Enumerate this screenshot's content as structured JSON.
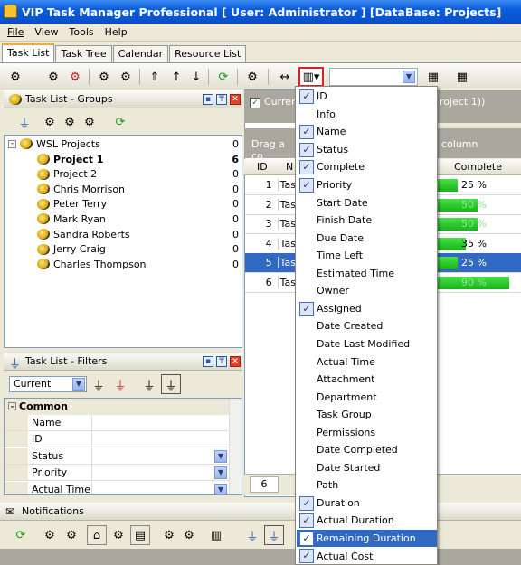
{
  "window": {
    "title": "VIP Task Manager Professional [ User: Administrator ] [DataBase: Projects]"
  },
  "menu": [
    "File",
    "View",
    "Tools",
    "Help"
  ],
  "tabs": [
    "Task List",
    "Task Tree",
    "Calendar",
    "Resource List"
  ],
  "groups_panel": {
    "title": "Task List - Groups",
    "root": {
      "label": "WSL Projects",
      "count": "0"
    },
    "items": [
      {
        "label": "Project 1",
        "count": "6"
      },
      {
        "label": "Project 2",
        "count": "0"
      },
      {
        "label": "Chris Morrison",
        "count": "0"
      },
      {
        "label": "Peter Terry",
        "count": "0"
      },
      {
        "label": "Mark Ryan",
        "count": "0"
      },
      {
        "label": "Sandra Roberts",
        "count": "0"
      },
      {
        "label": "Jerry Craig",
        "count": "0"
      },
      {
        "label": "Charles Thompson",
        "count": "0"
      }
    ]
  },
  "filters_panel": {
    "title": "Task List - Filters",
    "current": "Current",
    "section": "Common",
    "props": [
      "Name",
      "ID",
      "Status",
      "Priority",
      "Actual Time"
    ]
  },
  "grid": {
    "current_label": "Curren",
    "group_hint": "Drag a co",
    "group_hint2": "column",
    "caption_tail": "roject 1))",
    "columns": {
      "id": "ID",
      "name": "N",
      "complete": "Complete"
    },
    "rows": [
      {
        "id": "1",
        "name": "Tas",
        "complete": "25 %",
        "pct": 25
      },
      {
        "id": "2",
        "name": "Tas",
        "complete": "50 %",
        "pct": 50
      },
      {
        "id": "3",
        "name": "Tas",
        "complete": "50 %",
        "pct": 50
      },
      {
        "id": "4",
        "name": "Tas",
        "complete": "35 %",
        "pct": 35
      },
      {
        "id": "5",
        "name": "Tas",
        "complete": "25 %",
        "pct": 25
      },
      {
        "id": "6",
        "name": "Tas",
        "complete": "90 %",
        "pct": 90
      }
    ],
    "footer_count": "6"
  },
  "column_menu": [
    {
      "label": "ID",
      "checked": true
    },
    {
      "label": "Info",
      "checked": false
    },
    {
      "label": "Name",
      "checked": true
    },
    {
      "label": "Status",
      "checked": true
    },
    {
      "label": "Complete",
      "checked": true
    },
    {
      "label": "Priority",
      "checked": true
    },
    {
      "label": "Start Date",
      "checked": false
    },
    {
      "label": "Finish Date",
      "checked": false
    },
    {
      "label": "Due Date",
      "checked": false
    },
    {
      "label": "Time Left",
      "checked": false
    },
    {
      "label": "Estimated Time",
      "checked": false
    },
    {
      "label": "Owner",
      "checked": false
    },
    {
      "label": "Assigned",
      "checked": true
    },
    {
      "label": "Date Created",
      "checked": false
    },
    {
      "label": "Date Last Modified",
      "checked": false
    },
    {
      "label": "Actual Time",
      "checked": false
    },
    {
      "label": "Attachment",
      "checked": false
    },
    {
      "label": "Department",
      "checked": false
    },
    {
      "label": "Task Group",
      "checked": false
    },
    {
      "label": "Permissions",
      "checked": false
    },
    {
      "label": "Date Completed",
      "checked": false
    },
    {
      "label": "Date Started",
      "checked": false
    },
    {
      "label": "Path",
      "checked": false
    },
    {
      "label": "Duration",
      "checked": true
    },
    {
      "label": "Actual Duration",
      "checked": true
    },
    {
      "label": "Remaining Duration",
      "checked": true,
      "highlight": true
    },
    {
      "label": "Actual Cost",
      "checked": true
    }
  ],
  "notifications": {
    "title": "Notifications"
  },
  "colors": {
    "accent": "#316ac5",
    "progress": "#22c022",
    "title_bar": "#0a5ddc"
  }
}
